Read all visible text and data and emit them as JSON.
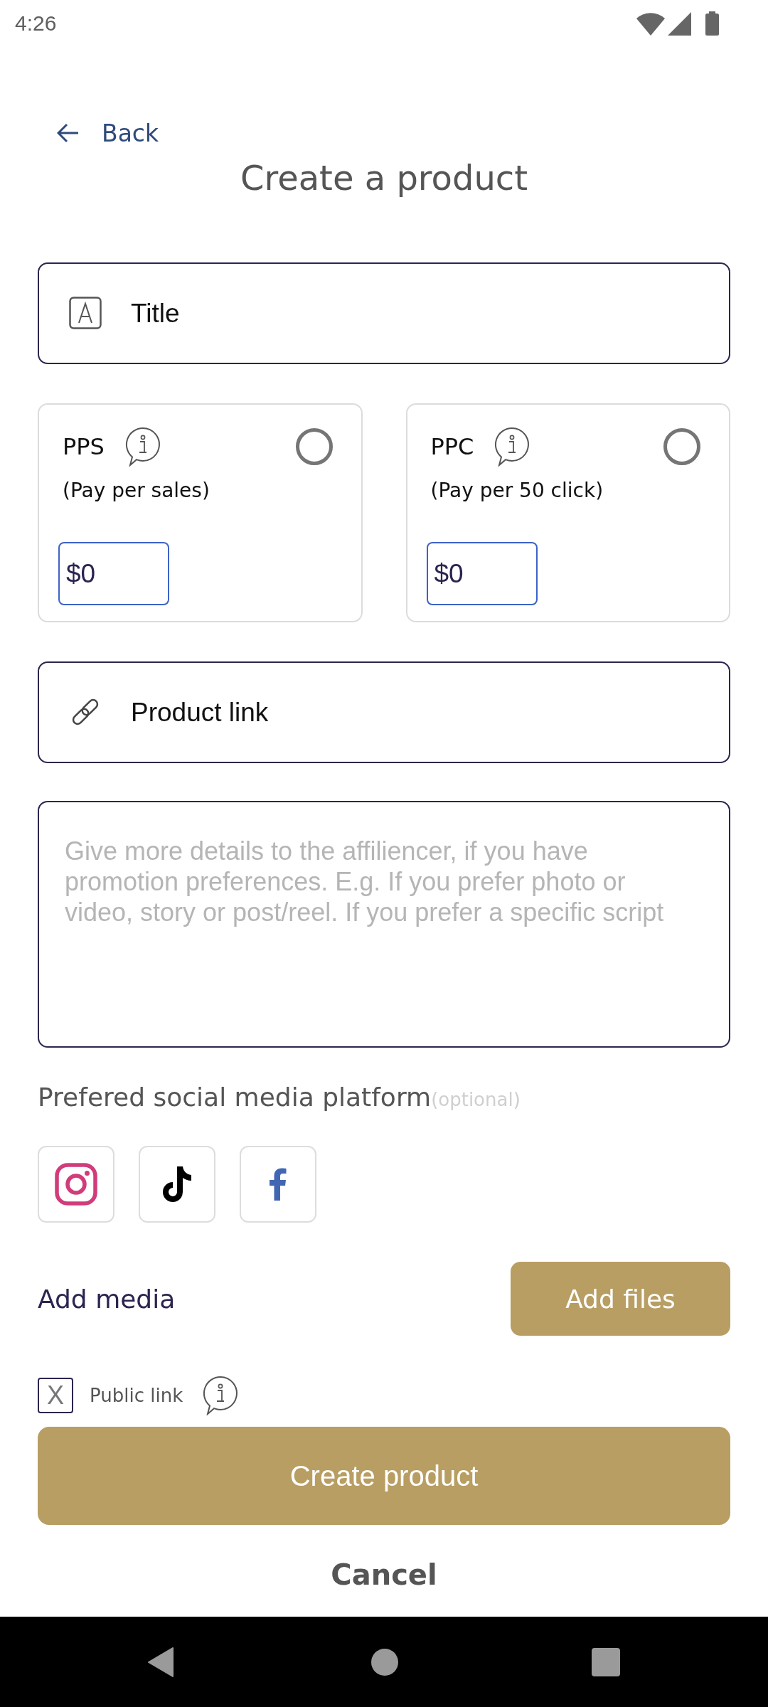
{
  "status_bar": {
    "time": "4:26"
  },
  "header": {
    "back_label": "Back",
    "title": "Create a product"
  },
  "title_field": {
    "placeholder": "Title"
  },
  "pricing_options": [
    {
      "label": "PPS",
      "description": "(Pay per sales)",
      "selected": false,
      "value": "$0"
    },
    {
      "label": "PPC",
      "description": "(Pay per 50 click)",
      "selected": false,
      "value": "$0"
    }
  ],
  "product_link_field": {
    "placeholder": "Product link"
  },
  "details_field": {
    "placeholder": "Give more details to the affiliencer, if you have promotion preferences. E.g. If you prefer photo or video, story or post/reel. If you prefer a specific script"
  },
  "social_platforms": {
    "label": "Prefered social media platform",
    "hint": "(optional)",
    "items": [
      {
        "kind": "instagram",
        "selected": false
      },
      {
        "kind": "tiktok",
        "selected": false
      },
      {
        "kind": "facebook",
        "selected": false
      }
    ]
  },
  "media": {
    "label": "Add media",
    "button": "Add files"
  },
  "public_link": {
    "checked": true,
    "mark": "X",
    "label": "Public link"
  },
  "primary_button": "Create product",
  "cancel_button": "Cancel"
}
